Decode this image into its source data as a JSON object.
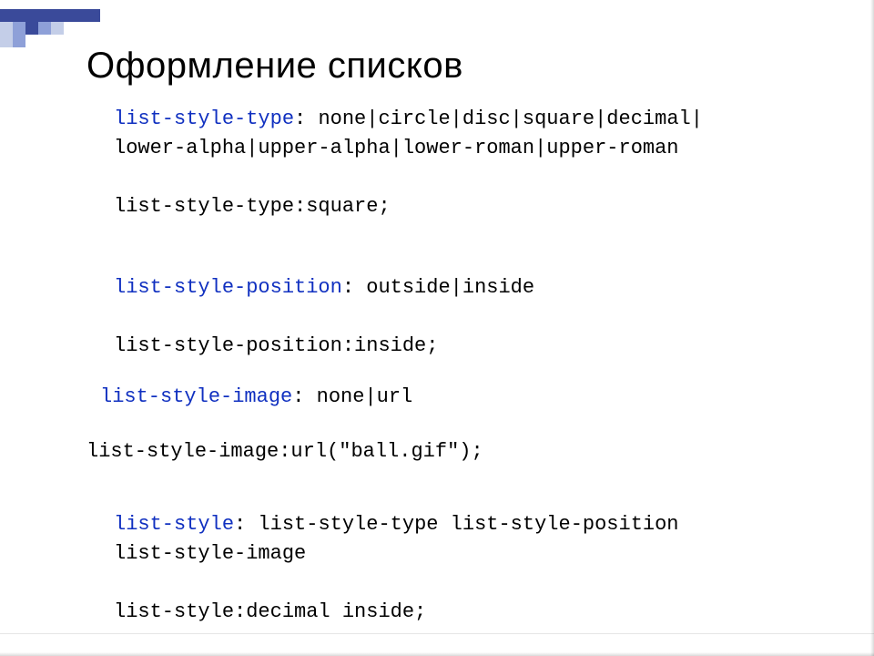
{
  "title": "Оформление списков",
  "blocks": {
    "b1": {
      "prop": "list-style-type",
      "values": " none|circle|disc|square|decimal|",
      "values2": "lower-alpha|upper-alpha|lower-roman|upper-roman",
      "example": "list-style-type:square;"
    },
    "b2": {
      "prop": "list-style-position",
      "values": " outside|inside",
      "example": "list-style-position:inside;"
    },
    "b3": {
      "prop": "list-style-image",
      "values": " none|url",
      "example": "list-style-image:url(\"ball.gif\");"
    },
    "b4": {
      "prop": "list-style",
      "values": " list-style-type list-style-position",
      "values2": "list-style-image",
      "example": "list-style:decimal inside;"
    }
  }
}
